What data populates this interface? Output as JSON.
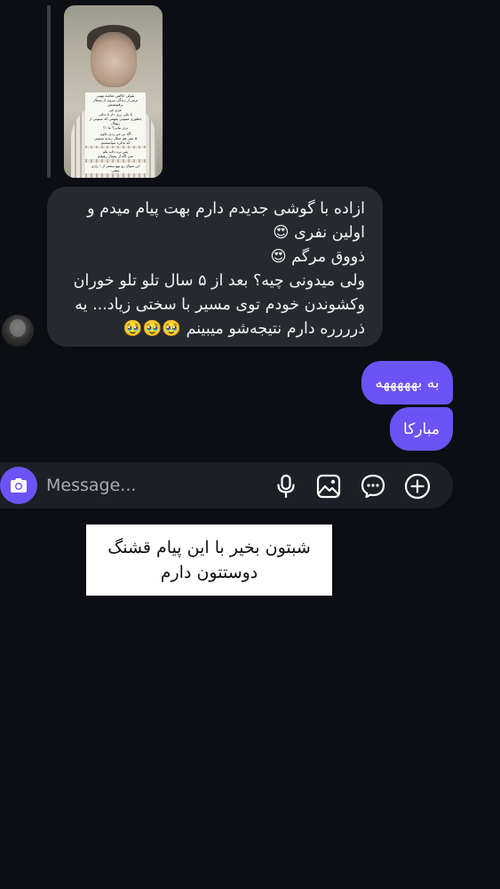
{
  "thread": {
    "story_reply": {
      "captions": [
        "بقولی خاکس تماشه بهینی\nترس از زندگی بیرون از پستال برقبینمیش",
        "عزیز من\nبا یکی زری دار یا دیکی\nچطوری میتونی بفهمی که میتونی از ریهنال\nبزی بیایی؟ ما ۱؟",
        "اگه بی من زدی بکوی\n۵ عمر هم شکل زندیه میتونی\nکه تذکره سپاسشتم",
        "پس بره دلاید بکو\nمنن اگه از پستال رفیلیم",
        "این سوال رو بهو بیشتر از ۱ رازی بیشی"
      ]
    },
    "incoming_message": "ازاده با گوشی جدیدم دارم بهت پیام میدم و\nاولین نفری 😍\nذووق مرگم 😍\nولی میدونی چیه؟ بعد از ۵ سال تلو تلو خوران\nوکشوندن خودم توی مسیر با سختی زیاد... یه\nذرررره دارم نتیجه‌شو میبینم 🥹🥹🥹",
    "outgoing_messages": [
      "به بهههههه",
      "مبارکا"
    ]
  },
  "composer": {
    "placeholder": "Message...",
    "icons": [
      "camera-icon",
      "microphone-icon",
      "image-icon",
      "sticker-icon",
      "add-icon"
    ]
  },
  "overlay_caption": "شبتون بخیر با این پیام قشنگ\nدوستتون دارم",
  "colors": {
    "background": "#0b0f14",
    "incoming_bubble": "#262a30",
    "outgoing_bubble": "#6c53f5",
    "composer": "#1c2026"
  }
}
